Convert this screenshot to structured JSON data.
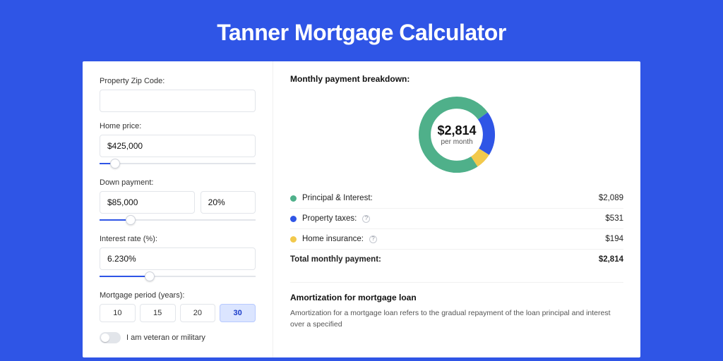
{
  "title": "Tanner Mortgage Calculator",
  "form": {
    "zip_label": "Property Zip Code:",
    "zip_value": "",
    "price_label": "Home price:",
    "price_value": "$425,000",
    "price_slider_pct": 10,
    "down_label": "Down payment:",
    "down_value": "$85,000",
    "down_pct_value": "20%",
    "down_slider_pct": 20,
    "rate_label": "Interest rate (%):",
    "rate_value": "6.230%",
    "rate_slider_pct": 32,
    "period_label": "Mortgage period (years):",
    "periods": [
      "10",
      "15",
      "20",
      "30"
    ],
    "period_active_index": 3,
    "veteran_label": "I am veteran or military"
  },
  "breakdown": {
    "title": "Monthly payment breakdown:",
    "center_value": "$2,814",
    "center_sub": "per month",
    "items": [
      {
        "label": "Principal & Interest:",
        "value": "$2,089",
        "color": "#4fb08a",
        "info": false
      },
      {
        "label": "Property taxes:",
        "value": "$531",
        "color": "#2f55e6",
        "info": true
      },
      {
        "label": "Home insurance:",
        "value": "$194",
        "color": "#f2c94c",
        "info": true
      }
    ],
    "total_label": "Total monthly payment:",
    "total_value": "$2,814"
  },
  "chart_data": {
    "type": "pie",
    "title": "Monthly payment breakdown",
    "series": [
      {
        "name": "Principal & Interest",
        "value": 2089,
        "color": "#4fb08a"
      },
      {
        "name": "Property taxes",
        "value": 531,
        "color": "#2f55e6"
      },
      {
        "name": "Home insurance",
        "value": 194,
        "color": "#f2c94c"
      }
    ],
    "total": 2814
  },
  "amortization": {
    "title": "Amortization for mortgage loan",
    "text": "Amortization for a mortgage loan refers to the gradual repayment of the loan principal and interest over a specified"
  }
}
